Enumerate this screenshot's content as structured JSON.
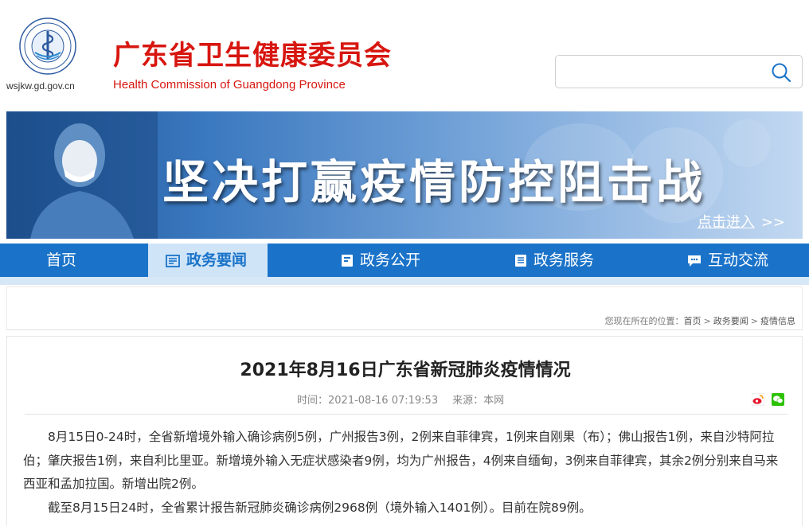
{
  "header": {
    "domain": "wsjkw.gd.gov.cn",
    "title_cn": "广东省卫生健康委员会",
    "title_en": "Health Commission of Guangdong Province",
    "search_placeholder": "",
    "brand_color": "#d7160f"
  },
  "banner": {
    "slogan": "坚决打赢疫情防控阻击战",
    "enter_label": "点击进入",
    "enter_arrow": ">>"
  },
  "nav": {
    "color": "#1a73c9",
    "items": [
      {
        "label": "首页",
        "icon": ""
      },
      {
        "label": "政务要闻",
        "icon": "news-icon",
        "active": true
      },
      {
        "label": "政务公开",
        "icon": "book-icon"
      },
      {
        "label": "政务服务",
        "icon": "document-icon"
      },
      {
        "label": "互动交流",
        "icon": "chat-icon"
      }
    ]
  },
  "breadcrumb": {
    "prefix": "您现在所在的位置：",
    "items": [
      "首页",
      "政务要闻",
      "疫情信息"
    ],
    "separator": ">"
  },
  "article": {
    "title": "2021年8月16日广东省新冠肺炎疫情情况",
    "time_label": "时间：",
    "time": "2021-08-16 07:19:53",
    "source_label": "来源：",
    "source": "本网",
    "paragraphs": [
      "8月15日0-24时，全省新增境外输入确诊病例5例，广州报告3例，2例来自菲律宾，1例来自刚果（布）；佛山报告1例，来自沙特阿拉伯；肇庆报告1例，来自利比里亚。新增境外输入无症状感染者9例，均为广州报告，4例来自缅甸，3例来自菲律宾，其余2例分别来自马来西亚和孟加拉国。新增出院2例。",
      "截至8月15日24时，全省累计报告新冠肺炎确诊病例2968例（境外输入1401例）。目前在院89例。"
    ],
    "share_icons": [
      "weibo-icon",
      "wechat-icon"
    ]
  }
}
